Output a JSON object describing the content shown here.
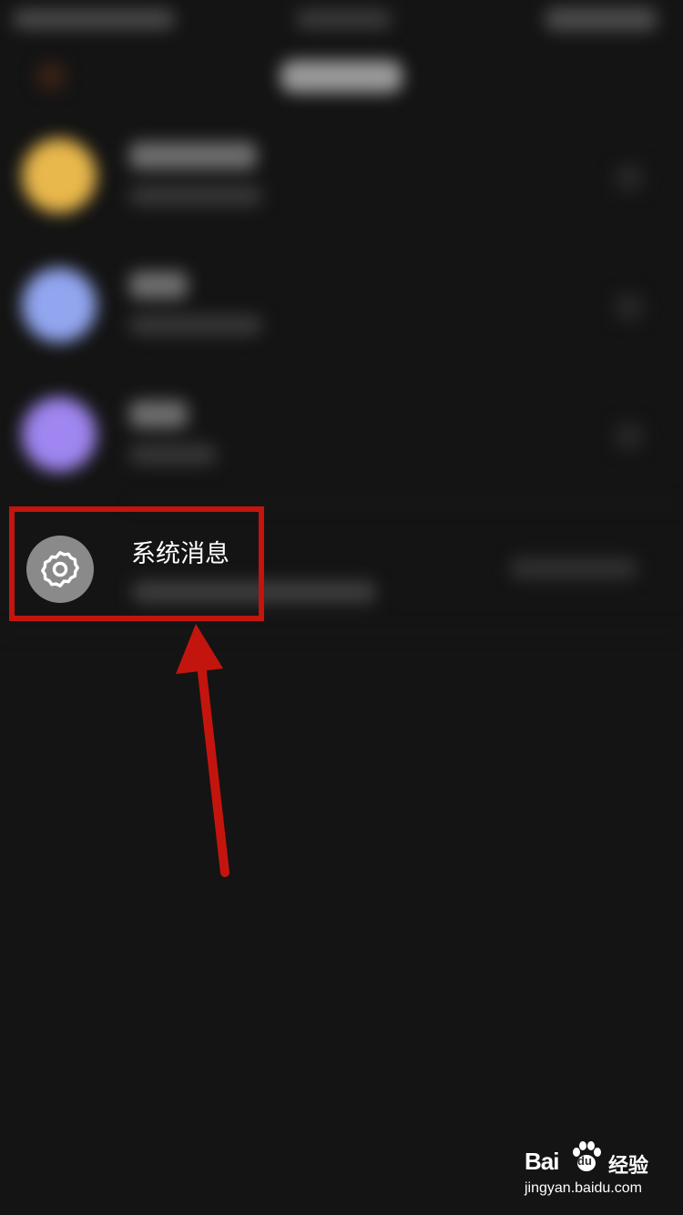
{
  "system_message": {
    "title": "系统消息",
    "icon": "gear-icon"
  },
  "background_rows": [
    {
      "avatar_color": "#e9b84c"
    },
    {
      "avatar_color": "#92a6f0"
    },
    {
      "avatar_color": "#9f86f0"
    }
  ],
  "annotation": {
    "color": "#c3150e"
  },
  "watermark": {
    "brand_left": "Bai",
    "brand_paw": "du",
    "brand_right": "经验",
    "url": "jingyan.baidu.com"
  }
}
